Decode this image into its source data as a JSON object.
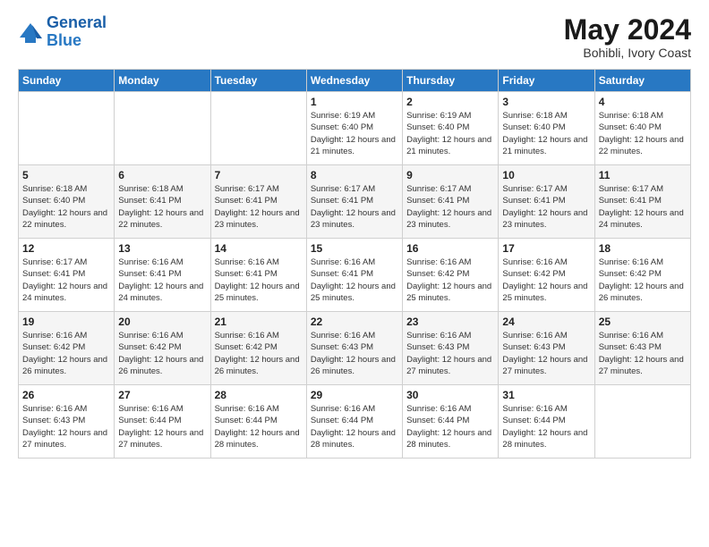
{
  "logo": {
    "line1": "General",
    "line2": "Blue"
  },
  "title": "May 2024",
  "location": "Bohibli, Ivory Coast",
  "weekdays": [
    "Sunday",
    "Monday",
    "Tuesday",
    "Wednesday",
    "Thursday",
    "Friday",
    "Saturday"
  ],
  "weeks": [
    [
      {
        "day": "",
        "sunrise": "",
        "sunset": "",
        "daylight": ""
      },
      {
        "day": "",
        "sunrise": "",
        "sunset": "",
        "daylight": ""
      },
      {
        "day": "",
        "sunrise": "",
        "sunset": "",
        "daylight": ""
      },
      {
        "day": "1",
        "sunrise": "Sunrise: 6:19 AM",
        "sunset": "Sunset: 6:40 PM",
        "daylight": "Daylight: 12 hours and 21 minutes."
      },
      {
        "day": "2",
        "sunrise": "Sunrise: 6:19 AM",
        "sunset": "Sunset: 6:40 PM",
        "daylight": "Daylight: 12 hours and 21 minutes."
      },
      {
        "day": "3",
        "sunrise": "Sunrise: 6:18 AM",
        "sunset": "Sunset: 6:40 PM",
        "daylight": "Daylight: 12 hours and 21 minutes."
      },
      {
        "day": "4",
        "sunrise": "Sunrise: 6:18 AM",
        "sunset": "Sunset: 6:40 PM",
        "daylight": "Daylight: 12 hours and 22 minutes."
      }
    ],
    [
      {
        "day": "5",
        "sunrise": "Sunrise: 6:18 AM",
        "sunset": "Sunset: 6:40 PM",
        "daylight": "Daylight: 12 hours and 22 minutes."
      },
      {
        "day": "6",
        "sunrise": "Sunrise: 6:18 AM",
        "sunset": "Sunset: 6:41 PM",
        "daylight": "Daylight: 12 hours and 22 minutes."
      },
      {
        "day": "7",
        "sunrise": "Sunrise: 6:17 AM",
        "sunset": "Sunset: 6:41 PM",
        "daylight": "Daylight: 12 hours and 23 minutes."
      },
      {
        "day": "8",
        "sunrise": "Sunrise: 6:17 AM",
        "sunset": "Sunset: 6:41 PM",
        "daylight": "Daylight: 12 hours and 23 minutes."
      },
      {
        "day": "9",
        "sunrise": "Sunrise: 6:17 AM",
        "sunset": "Sunset: 6:41 PM",
        "daylight": "Daylight: 12 hours and 23 minutes."
      },
      {
        "day": "10",
        "sunrise": "Sunrise: 6:17 AM",
        "sunset": "Sunset: 6:41 PM",
        "daylight": "Daylight: 12 hours and 23 minutes."
      },
      {
        "day": "11",
        "sunrise": "Sunrise: 6:17 AM",
        "sunset": "Sunset: 6:41 PM",
        "daylight": "Daylight: 12 hours and 24 minutes."
      }
    ],
    [
      {
        "day": "12",
        "sunrise": "Sunrise: 6:17 AM",
        "sunset": "Sunset: 6:41 PM",
        "daylight": "Daylight: 12 hours and 24 minutes."
      },
      {
        "day": "13",
        "sunrise": "Sunrise: 6:16 AM",
        "sunset": "Sunset: 6:41 PM",
        "daylight": "Daylight: 12 hours and 24 minutes."
      },
      {
        "day": "14",
        "sunrise": "Sunrise: 6:16 AM",
        "sunset": "Sunset: 6:41 PM",
        "daylight": "Daylight: 12 hours and 25 minutes."
      },
      {
        "day": "15",
        "sunrise": "Sunrise: 6:16 AM",
        "sunset": "Sunset: 6:41 PM",
        "daylight": "Daylight: 12 hours and 25 minutes."
      },
      {
        "day": "16",
        "sunrise": "Sunrise: 6:16 AM",
        "sunset": "Sunset: 6:42 PM",
        "daylight": "Daylight: 12 hours and 25 minutes."
      },
      {
        "day": "17",
        "sunrise": "Sunrise: 6:16 AM",
        "sunset": "Sunset: 6:42 PM",
        "daylight": "Daylight: 12 hours and 25 minutes."
      },
      {
        "day": "18",
        "sunrise": "Sunrise: 6:16 AM",
        "sunset": "Sunset: 6:42 PM",
        "daylight": "Daylight: 12 hours and 26 minutes."
      }
    ],
    [
      {
        "day": "19",
        "sunrise": "Sunrise: 6:16 AM",
        "sunset": "Sunset: 6:42 PM",
        "daylight": "Daylight: 12 hours and 26 minutes."
      },
      {
        "day": "20",
        "sunrise": "Sunrise: 6:16 AM",
        "sunset": "Sunset: 6:42 PM",
        "daylight": "Daylight: 12 hours and 26 minutes."
      },
      {
        "day": "21",
        "sunrise": "Sunrise: 6:16 AM",
        "sunset": "Sunset: 6:42 PM",
        "daylight": "Daylight: 12 hours and 26 minutes."
      },
      {
        "day": "22",
        "sunrise": "Sunrise: 6:16 AM",
        "sunset": "Sunset: 6:43 PM",
        "daylight": "Daylight: 12 hours and 26 minutes."
      },
      {
        "day": "23",
        "sunrise": "Sunrise: 6:16 AM",
        "sunset": "Sunset: 6:43 PM",
        "daylight": "Daylight: 12 hours and 27 minutes."
      },
      {
        "day": "24",
        "sunrise": "Sunrise: 6:16 AM",
        "sunset": "Sunset: 6:43 PM",
        "daylight": "Daylight: 12 hours and 27 minutes."
      },
      {
        "day": "25",
        "sunrise": "Sunrise: 6:16 AM",
        "sunset": "Sunset: 6:43 PM",
        "daylight": "Daylight: 12 hours and 27 minutes."
      }
    ],
    [
      {
        "day": "26",
        "sunrise": "Sunrise: 6:16 AM",
        "sunset": "Sunset: 6:43 PM",
        "daylight": "Daylight: 12 hours and 27 minutes."
      },
      {
        "day": "27",
        "sunrise": "Sunrise: 6:16 AM",
        "sunset": "Sunset: 6:44 PM",
        "daylight": "Daylight: 12 hours and 27 minutes."
      },
      {
        "day": "28",
        "sunrise": "Sunrise: 6:16 AM",
        "sunset": "Sunset: 6:44 PM",
        "daylight": "Daylight: 12 hours and 28 minutes."
      },
      {
        "day": "29",
        "sunrise": "Sunrise: 6:16 AM",
        "sunset": "Sunset: 6:44 PM",
        "daylight": "Daylight: 12 hours and 28 minutes."
      },
      {
        "day": "30",
        "sunrise": "Sunrise: 6:16 AM",
        "sunset": "Sunset: 6:44 PM",
        "daylight": "Daylight: 12 hours and 28 minutes."
      },
      {
        "day": "31",
        "sunrise": "Sunrise: 6:16 AM",
        "sunset": "Sunset: 6:44 PM",
        "daylight": "Daylight: 12 hours and 28 minutes."
      },
      {
        "day": "",
        "sunrise": "",
        "sunset": "",
        "daylight": ""
      }
    ]
  ]
}
